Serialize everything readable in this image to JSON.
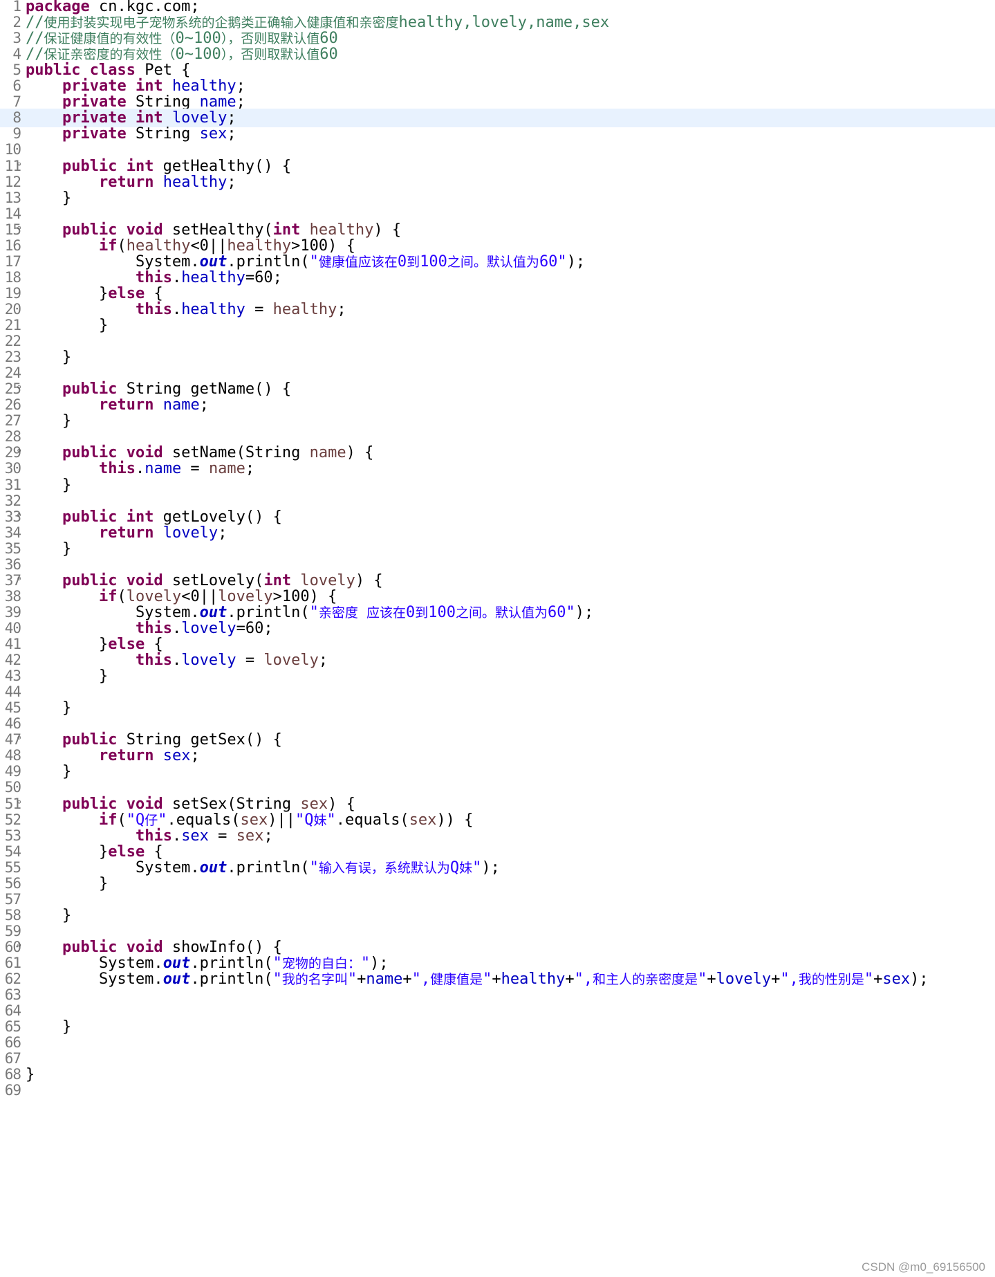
{
  "editor": {
    "current_line": 8,
    "fold_marker_lines": [
      11,
      15,
      25,
      29,
      33,
      37,
      47,
      51,
      60
    ],
    "lines": [
      [
        [
          "k",
          "package"
        ],
        [
          "p",
          " cn.kgc.com;"
        ]
      ],
      [
        [
          "c",
          "//"
        ],
        [
          "cc",
          "使用封装实现电子宠物系统的企鹅类正确输入健康值和亲密度"
        ],
        [
          "c",
          "healthy,lovely,name,sex"
        ]
      ],
      [
        [
          "c",
          "//"
        ],
        [
          "cc",
          "保证健康值的有效性（"
        ],
        [
          "c",
          "0~100"
        ],
        [
          "cc",
          "），否则取默认值"
        ],
        [
          "c",
          "60"
        ]
      ],
      [
        [
          "c",
          "//"
        ],
        [
          "cc",
          "保证亲密度的有效性（"
        ],
        [
          "c",
          "0~100"
        ],
        [
          "cc",
          "），否则取默认值"
        ],
        [
          "c",
          "60"
        ]
      ],
      [
        [
          "k",
          "public class"
        ],
        [
          "p",
          " Pet {"
        ]
      ],
      [
        [
          "p",
          "    "
        ],
        [
          "k",
          "private int"
        ],
        [
          "p",
          " "
        ],
        [
          "f",
          "healthy"
        ],
        [
          "p",
          ";"
        ]
      ],
      [
        [
          "p",
          "    "
        ],
        [
          "k",
          "private"
        ],
        [
          "p",
          " String "
        ],
        [
          "f",
          "name"
        ],
        [
          "p",
          ";"
        ]
      ],
      [
        [
          "p",
          "    "
        ],
        [
          "k",
          "private int"
        ],
        [
          "p",
          " "
        ],
        [
          "f",
          "lovely"
        ],
        [
          "p",
          ";"
        ]
      ],
      [
        [
          "p",
          "    "
        ],
        [
          "k",
          "private"
        ],
        [
          "p",
          " String "
        ],
        [
          "f",
          "sex"
        ],
        [
          "p",
          ";"
        ]
      ],
      [],
      [
        [
          "p",
          "    "
        ],
        [
          "k",
          "public int"
        ],
        [
          "p",
          " getHealthy() {"
        ]
      ],
      [
        [
          "p",
          "        "
        ],
        [
          "k",
          "return"
        ],
        [
          "p",
          " "
        ],
        [
          "f",
          "healthy"
        ],
        [
          "p",
          ";"
        ]
      ],
      [
        [
          "p",
          "    }"
        ]
      ],
      [],
      [
        [
          "p",
          "    "
        ],
        [
          "k",
          "public void"
        ],
        [
          "p",
          " setHealthy("
        ],
        [
          "k",
          "int"
        ],
        [
          "p",
          " "
        ],
        [
          "v",
          "healthy"
        ],
        [
          "p",
          ") {"
        ]
      ],
      [
        [
          "p",
          "        "
        ],
        [
          "k",
          "if"
        ],
        [
          "p",
          "("
        ],
        [
          "v",
          "healthy"
        ],
        [
          "p",
          "<0||"
        ],
        [
          "v",
          "healthy"
        ],
        [
          "p",
          ">100) {"
        ]
      ],
      [
        [
          "p",
          "            System."
        ],
        [
          "o",
          "out"
        ],
        [
          "p",
          ".println("
        ],
        [
          "s",
          "\""
        ],
        [
          "sc",
          "健康值应该在"
        ],
        [
          "s",
          "0"
        ],
        [
          "sc",
          "到"
        ],
        [
          "s",
          "100"
        ],
        [
          "sc",
          "之间。默认值为"
        ],
        [
          "s",
          "60\""
        ],
        [
          "p",
          ");"
        ]
      ],
      [
        [
          "p",
          "            "
        ],
        [
          "k",
          "this"
        ],
        [
          "p",
          "."
        ],
        [
          "f",
          "healthy"
        ],
        [
          "p",
          "=60;"
        ]
      ],
      [
        [
          "p",
          "        }"
        ],
        [
          "k",
          "else"
        ],
        [
          "p",
          " {"
        ]
      ],
      [
        [
          "p",
          "            "
        ],
        [
          "k",
          "this"
        ],
        [
          "p",
          "."
        ],
        [
          "f",
          "healthy"
        ],
        [
          "p",
          " = "
        ],
        [
          "v",
          "healthy"
        ],
        [
          "p",
          ";"
        ]
      ],
      [
        [
          "p",
          "        }"
        ]
      ],
      [],
      [
        [
          "p",
          "    }"
        ]
      ],
      [],
      [
        [
          "p",
          "    "
        ],
        [
          "k",
          "public"
        ],
        [
          "p",
          " String getName() {"
        ]
      ],
      [
        [
          "p",
          "        "
        ],
        [
          "k",
          "return"
        ],
        [
          "p",
          " "
        ],
        [
          "f",
          "name"
        ],
        [
          "p",
          ";"
        ]
      ],
      [
        [
          "p",
          "    }"
        ]
      ],
      [],
      [
        [
          "p",
          "    "
        ],
        [
          "k",
          "public void"
        ],
        [
          "p",
          " setName(String "
        ],
        [
          "v",
          "name"
        ],
        [
          "p",
          ") {"
        ]
      ],
      [
        [
          "p",
          "        "
        ],
        [
          "k",
          "this"
        ],
        [
          "p",
          "."
        ],
        [
          "f",
          "name"
        ],
        [
          "p",
          " = "
        ],
        [
          "v",
          "name"
        ],
        [
          "p",
          ";"
        ]
      ],
      [
        [
          "p",
          "    }"
        ]
      ],
      [],
      [
        [
          "p",
          "    "
        ],
        [
          "k",
          "public int"
        ],
        [
          "p",
          " getLovely() {"
        ]
      ],
      [
        [
          "p",
          "        "
        ],
        [
          "k",
          "return"
        ],
        [
          "p",
          " "
        ],
        [
          "f",
          "lovely"
        ],
        [
          "p",
          ";"
        ]
      ],
      [
        [
          "p",
          "    }"
        ]
      ],
      [],
      [
        [
          "p",
          "    "
        ],
        [
          "k",
          "public void"
        ],
        [
          "p",
          " setLovely("
        ],
        [
          "k",
          "int"
        ],
        [
          "p",
          " "
        ],
        [
          "v",
          "lovely"
        ],
        [
          "p",
          ") {"
        ]
      ],
      [
        [
          "p",
          "        "
        ],
        [
          "k",
          "if"
        ],
        [
          "p",
          "("
        ],
        [
          "v",
          "lovely"
        ],
        [
          "p",
          "<0||"
        ],
        [
          "v",
          "lovely"
        ],
        [
          "p",
          ">100) {"
        ]
      ],
      [
        [
          "p",
          "            System."
        ],
        [
          "o",
          "out"
        ],
        [
          "p",
          ".println("
        ],
        [
          "s",
          "\""
        ],
        [
          "sc",
          "亲密度  应该在"
        ],
        [
          "s",
          "0"
        ],
        [
          "sc",
          "到"
        ],
        [
          "s",
          "100"
        ],
        [
          "sc",
          "之间。默认值为"
        ],
        [
          "s",
          "60\""
        ],
        [
          "p",
          ");"
        ]
      ],
      [
        [
          "p",
          "            "
        ],
        [
          "k",
          "this"
        ],
        [
          "p",
          "."
        ],
        [
          "f",
          "lovely"
        ],
        [
          "p",
          "=60;"
        ]
      ],
      [
        [
          "p",
          "        }"
        ],
        [
          "k",
          "else"
        ],
        [
          "p",
          " {"
        ]
      ],
      [
        [
          "p",
          "            "
        ],
        [
          "k",
          "this"
        ],
        [
          "p",
          "."
        ],
        [
          "f",
          "lovely"
        ],
        [
          "p",
          " = "
        ],
        [
          "v",
          "lovely"
        ],
        [
          "p",
          ";"
        ]
      ],
      [
        [
          "p",
          "        }"
        ]
      ],
      [],
      [
        [
          "p",
          "    }"
        ]
      ],
      [],
      [
        [
          "p",
          "    "
        ],
        [
          "k",
          "public"
        ],
        [
          "p",
          " String getSex() {"
        ]
      ],
      [
        [
          "p",
          "        "
        ],
        [
          "k",
          "return"
        ],
        [
          "p",
          " "
        ],
        [
          "f",
          "sex"
        ],
        [
          "p",
          ";"
        ]
      ],
      [
        [
          "p",
          "    }"
        ]
      ],
      [],
      [
        [
          "p",
          "    "
        ],
        [
          "k",
          "public void"
        ],
        [
          "p",
          " setSex(String "
        ],
        [
          "v",
          "sex"
        ],
        [
          "p",
          ") {"
        ]
      ],
      [
        [
          "p",
          "        "
        ],
        [
          "k",
          "if"
        ],
        [
          "p",
          "("
        ],
        [
          "s",
          "\"Q"
        ],
        [
          "sc",
          "仔"
        ],
        [
          "s",
          "\""
        ],
        [
          "p",
          ".equals("
        ],
        [
          "v",
          "sex"
        ],
        [
          "p",
          ")||"
        ],
        [
          "s",
          "\"Q"
        ],
        [
          "sc",
          "妹"
        ],
        [
          "s",
          "\""
        ],
        [
          "p",
          ".equals("
        ],
        [
          "v",
          "sex"
        ],
        [
          "p",
          ")) {"
        ]
      ],
      [
        [
          "p",
          "            "
        ],
        [
          "k",
          "this"
        ],
        [
          "p",
          "."
        ],
        [
          "f",
          "sex"
        ],
        [
          "p",
          " = "
        ],
        [
          "v",
          "sex"
        ],
        [
          "p",
          ";"
        ]
      ],
      [
        [
          "p",
          "        }"
        ],
        [
          "k",
          "else"
        ],
        [
          "p",
          " {"
        ]
      ],
      [
        [
          "p",
          "            System."
        ],
        [
          "o",
          "out"
        ],
        [
          "p",
          ".println("
        ],
        [
          "s",
          "\""
        ],
        [
          "sc",
          "输入有误，系统默认为"
        ],
        [
          "s",
          "Q"
        ],
        [
          "sc",
          "妹"
        ],
        [
          "s",
          "\""
        ],
        [
          "p",
          ");"
        ]
      ],
      [
        [
          "p",
          "        }"
        ]
      ],
      [],
      [
        [
          "p",
          "    }"
        ]
      ],
      [],
      [
        [
          "p",
          "    "
        ],
        [
          "k",
          "public void"
        ],
        [
          "p",
          " showInfo() {"
        ]
      ],
      [
        [
          "p",
          "        System."
        ],
        [
          "o",
          "out"
        ],
        [
          "p",
          ".println("
        ],
        [
          "s",
          "\""
        ],
        [
          "sc",
          "宠物的自白："
        ],
        [
          "s",
          "\""
        ],
        [
          "p",
          ");"
        ]
      ],
      [
        [
          "p",
          "        System."
        ],
        [
          "o",
          "out"
        ],
        [
          "p",
          ".println("
        ],
        [
          "s",
          "\""
        ],
        [
          "sc",
          "我的名字叫"
        ],
        [
          "s",
          "\""
        ],
        [
          "p",
          "+"
        ],
        [
          "f",
          "name"
        ],
        [
          "p",
          "+"
        ],
        [
          "s",
          "\","
        ],
        [
          "sc",
          "健康值是"
        ],
        [
          "s",
          "\""
        ],
        [
          "p",
          "+"
        ],
        [
          "f",
          "healthy"
        ],
        [
          "p",
          "+"
        ],
        [
          "s",
          "\","
        ],
        [
          "sc",
          "和主人的亲密度是"
        ],
        [
          "s",
          "\""
        ],
        [
          "p",
          "+"
        ],
        [
          "f",
          "lovely"
        ],
        [
          "p",
          "+"
        ],
        [
          "s",
          "\","
        ],
        [
          "sc",
          "我的性别是"
        ],
        [
          "s",
          "\""
        ],
        [
          "p",
          "+"
        ],
        [
          "f",
          "sex"
        ],
        [
          "p",
          ");"
        ]
      ],
      [],
      [],
      [
        [
          "p",
          "    }"
        ]
      ],
      [],
      [],
      [
        [
          "p",
          "}"
        ]
      ],
      []
    ]
  },
  "watermark": "CSDN @m0_69156500"
}
